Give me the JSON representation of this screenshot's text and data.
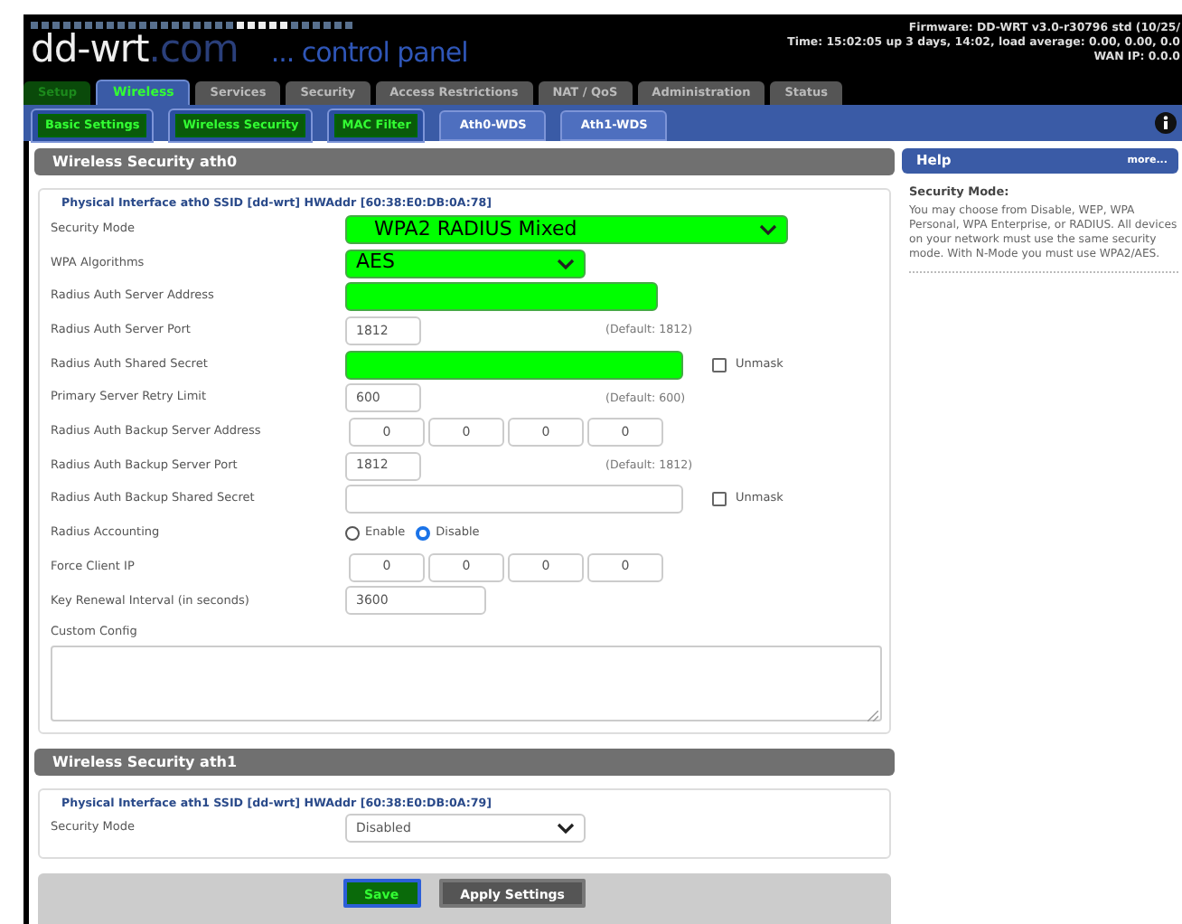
{
  "header": {
    "logo": "dd-wrt",
    "logo_suffix": ".com",
    "subtitle": "... control panel",
    "firmware": "Firmware: DD-WRT v3.0-r30796 std (10/25/",
    "time": "Time: 15:02:05 up 3 days, 14:02, load average: 0.00, 0.00, 0.0",
    "wan_ip": "WAN IP: 0.0.0"
  },
  "tabs": [
    {
      "label": "Setup",
      "selected": false,
      "highlight": true
    },
    {
      "label": "Wireless",
      "selected": true,
      "highlight": true
    },
    {
      "label": "Services",
      "selected": false,
      "highlight": false
    },
    {
      "label": "Security",
      "selected": false,
      "highlight": false
    },
    {
      "label": "Access Restrictions",
      "selected": false,
      "highlight": false
    },
    {
      "label": "NAT / QoS",
      "selected": false,
      "highlight": false
    },
    {
      "label": "Administration",
      "selected": false,
      "highlight": false
    },
    {
      "label": "Status",
      "selected": false,
      "highlight": false
    }
  ],
  "subtabs": [
    {
      "label": "Basic Settings",
      "highlight": true
    },
    {
      "label": "Wireless Security",
      "highlight": true
    },
    {
      "label": "MAC Filter",
      "highlight": true
    },
    {
      "label": "Ath0-WDS",
      "highlight": false
    },
    {
      "label": "Ath1-WDS",
      "highlight": false
    }
  ],
  "sections": [
    {
      "title": "Wireless Security ath0",
      "legend": "Physical Interface ath0 SSID [dd-wrt] HWAddr [60:38:E0:DB:0A:78]",
      "rows": [
        {
          "kind": "select",
          "label": "Security Mode",
          "value": "WPA2 RADIUS Mixed",
          "highlight": true
        },
        {
          "kind": "select",
          "label": "WPA Algorithms",
          "value": "AES",
          "highlight": true
        },
        {
          "kind": "text",
          "label": "Radius Auth Server Address",
          "highlight": true
        },
        {
          "kind": "text",
          "label": "Radius Auth Server Port",
          "value": "1812",
          "highlight": false,
          "hint": "(Default: 1812)"
        },
        {
          "kind": "text",
          "label": "Radius Auth Shared Secret",
          "highlight": true,
          "unmask": {
            "label": "Unmask",
            "checked": false
          }
        },
        {
          "kind": "text",
          "label": "Primary Server Retry Limit",
          "value": "600",
          "highlight": false,
          "hint": "(Default: 600)"
        },
        {
          "kind": "ip",
          "label": "Radius Auth Backup Server Address",
          "octets": [
            "0",
            "0",
            "0",
            "0"
          ]
        },
        {
          "kind": "text",
          "label": "Radius Auth Backup Server Port",
          "value": "1812",
          "highlight": false,
          "hint": "(Default: 1812)"
        },
        {
          "kind": "text",
          "label": "Radius Auth Backup Shared Secret",
          "highlight": false,
          "unmask": {
            "label": "Unmask",
            "checked": false
          }
        },
        {
          "kind": "radio",
          "label": "Radius Accounting",
          "options": [
            {
              "label": "Enable",
              "selected": false
            },
            {
              "label": "Disable",
              "selected": true
            }
          ]
        },
        {
          "kind": "ip",
          "label": "Force Client IP",
          "octets": [
            "0",
            "0",
            "0",
            "0"
          ]
        },
        {
          "kind": "text",
          "label": "Key Renewal Interval (in seconds)",
          "value": "3600",
          "highlight": false
        },
        {
          "kind": "textarea",
          "label": "Custom Config"
        }
      ]
    },
    {
      "title": "Wireless Security ath1",
      "legend": "Physical Interface ath1 SSID [dd-wrt] HWAddr [60:38:E0:DB:0A:79]",
      "rows": [
        {
          "kind": "select",
          "label": "Security Mode",
          "value": "Disabled",
          "highlight": false
        }
      ]
    }
  ],
  "help": {
    "title": "Help",
    "more": "more...",
    "heading": "Security Mode:",
    "text": "You may choose from Disable, WEP, WPA Personal, WPA Enterprise, or RADIUS. All devices on your network must use the same security mode. With N-Mode you must use WPA2/AES."
  },
  "buttons": [
    {
      "label": "Save",
      "highlight": true
    },
    {
      "label": "Apply Settings",
      "highlight": false
    }
  ]
}
